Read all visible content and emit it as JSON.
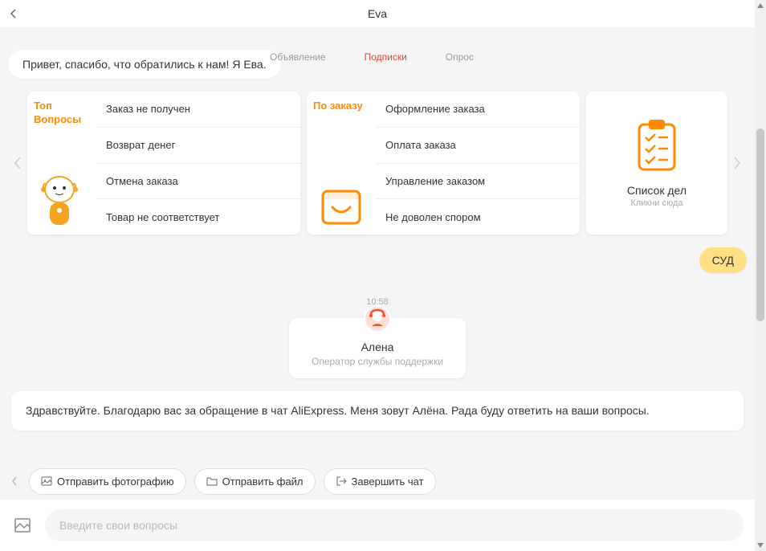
{
  "header": {
    "title": "Eva"
  },
  "tabs": {
    "t1": "Объявление",
    "t2": "Подписки",
    "t3": "Опрос"
  },
  "intro": "Привет, спасибо, что обратились к нам! Я Ева.",
  "card_top": {
    "title": "Топ Вопросы",
    "q1": "Заказ не получен",
    "q2": "Возврат денег",
    "q3": "Отмена заказа",
    "q4": "Товар не соответствует"
  },
  "card_order": {
    "title": "По заказу",
    "q1": "Оформление заказа",
    "q2": "Оплата заказа",
    "q3": "Управление заказом",
    "q4": "Не доволен спором"
  },
  "card_todo": {
    "title": "Список дел",
    "sub": "Кликни сюда"
  },
  "user_msg": "СУД",
  "time": "10:58",
  "operator": {
    "name": "Алена",
    "sub": "Оператор службы поддержки"
  },
  "greet": "Здравствуйте. Благодарю вас за обращение в чат AliExpress. Меня зовут Алёна. Рада буду ответить на ваши вопросы.",
  "actions": {
    "photo": "Отправить фотографию",
    "file": "Отправить файл",
    "end": "Завершить чат"
  },
  "input": {
    "placeholder": "Введите свои вопросы"
  }
}
